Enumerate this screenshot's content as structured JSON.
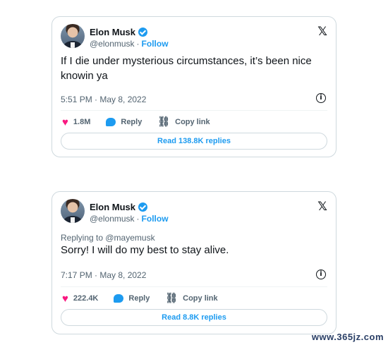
{
  "tweets": [
    {
      "author": "Elon Musk",
      "handle": "@elonmusk",
      "separator": "·",
      "follow_label": "Follow",
      "reply_to": "",
      "text": "If I die under mysterious circumstances, it’s been nice knowin ya",
      "timestamp": "5:51 PM · May 8, 2022",
      "likes": "1.8M",
      "reply_label": "Reply",
      "copy_label": "Copy link",
      "read_replies": "Read 138.8K replies"
    },
    {
      "author": "Elon Musk",
      "handle": "@elonmusk",
      "separator": "·",
      "follow_label": "Follow",
      "reply_to": "Replying to @mayemusk",
      "text": "Sorry! I will do my best to stay alive.",
      "timestamp": "7:17 PM · May 8, 2022",
      "likes": "222.4K",
      "reply_label": "Reply",
      "copy_label": "Copy link",
      "read_replies": "Read 8.8K replies"
    }
  ],
  "icons": {
    "logo": "x-logo-icon",
    "verified": "verified-badge-icon",
    "info": "info-icon",
    "like": "heart-icon",
    "reply": "reply-bubble-icon",
    "copy": "link-icon"
  },
  "colors": {
    "accent": "#1d9bf0",
    "like": "#f91880",
    "border": "#cfd9de",
    "muted": "#536471"
  },
  "watermark": "www.365jz.com"
}
